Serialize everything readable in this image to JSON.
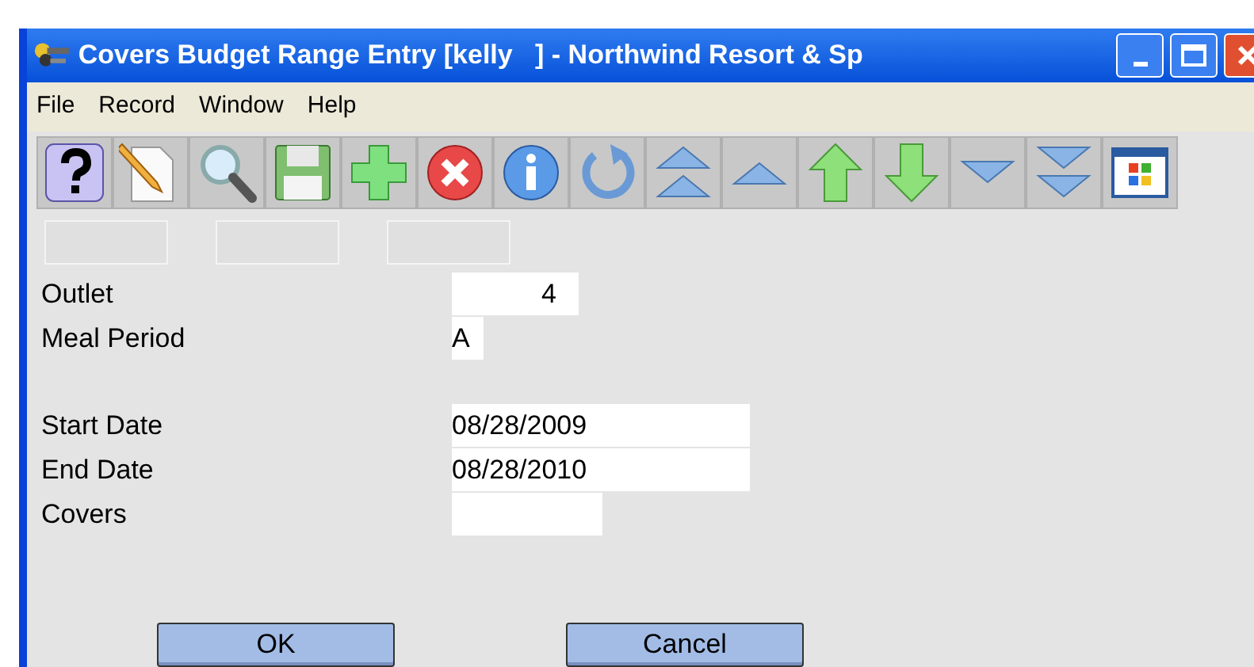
{
  "window": {
    "title": "Covers Budget Range Entry [kelly   ] - Northwind Resort & Sp"
  },
  "menu": [
    "File",
    "Record",
    "Window",
    "Help"
  ],
  "toolbar": [
    {
      "kind": "help"
    },
    {
      "kind": "new"
    },
    {
      "kind": "search"
    },
    {
      "kind": "save"
    },
    {
      "kind": "add"
    },
    {
      "kind": "delete"
    },
    {
      "kind": "info"
    },
    {
      "kind": "undo"
    },
    {
      "kind": "first"
    },
    {
      "kind": "previous"
    },
    {
      "kind": "up"
    },
    {
      "kind": "down"
    },
    {
      "kind": "next"
    },
    {
      "kind": "last"
    },
    {
      "kind": "window"
    }
  ],
  "field_groups": [
    [
      {
        "label": "Outlet",
        "value": "4",
        "kind": "number"
      },
      {
        "label": "Meal Period",
        "value": "A",
        "kind": "code"
      }
    ],
    [
      {
        "label": "Start Date",
        "value": "08/28/2009",
        "kind": "date"
      },
      {
        "label": "End Date",
        "value": "08/28/2010",
        "kind": "date"
      },
      {
        "label": "Covers",
        "kind": "amount"
      }
    ]
  ],
  "buttons": [
    "OK",
    "Cancel"
  ]
}
